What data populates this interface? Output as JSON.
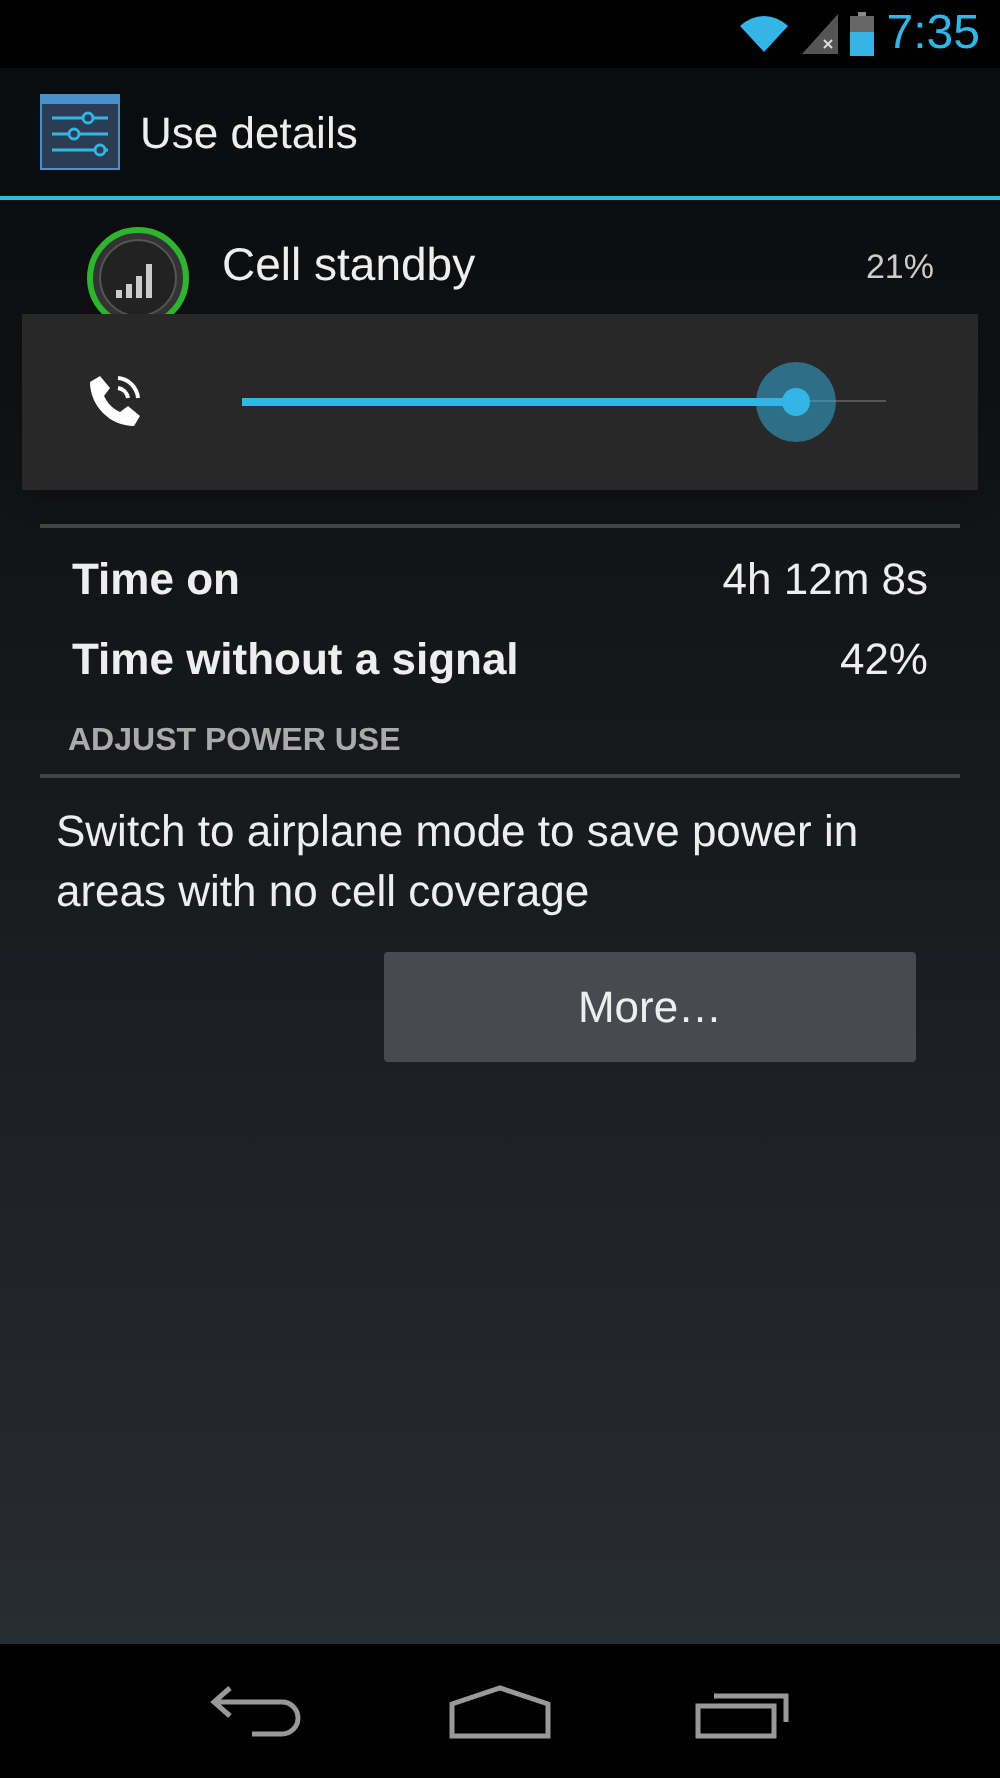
{
  "status_bar": {
    "time": "7:35"
  },
  "action_bar": {
    "title": "Use details"
  },
  "app": {
    "name": "Cell standby",
    "percent": "21%"
  },
  "volume_panel": {
    "level": 0.86
  },
  "use_details": {
    "rows": [
      {
        "label": "Time on",
        "value": "4h 12m 8s"
      },
      {
        "label": "Time without a signal",
        "value": "42%"
      }
    ]
  },
  "adjust": {
    "header": "ADJUST POWER USE",
    "text": "Switch to airplane mode to save power in areas with no cell coverage",
    "button": "More…"
  }
}
